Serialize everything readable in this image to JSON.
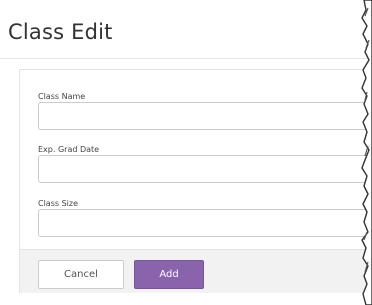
{
  "modal": {
    "title": "Class Edit"
  },
  "form": {
    "fields": [
      {
        "label": "Class Name",
        "value": "",
        "placeholder": ""
      },
      {
        "label": "Exp. Grad Date",
        "value": "",
        "placeholder": ""
      },
      {
        "label": "Class Size",
        "value": "",
        "placeholder": ""
      }
    ]
  },
  "footer": {
    "cancel_label": "Cancel",
    "add_label": "Add"
  },
  "colors": {
    "accent": "#8a63ad",
    "footer_bg": "#f2f2f2",
    "border": "#cccccc"
  }
}
